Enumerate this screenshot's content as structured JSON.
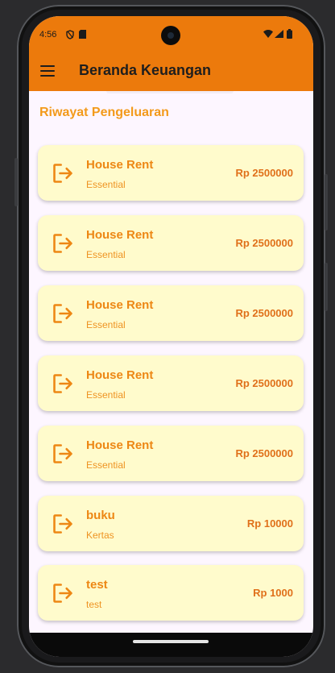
{
  "status_bar": {
    "time": "4:56",
    "left_icons": [
      "shield-icon",
      "sim-card-icon"
    ],
    "right_icons": [
      "wifi-icon",
      "signal-icon",
      "battery-icon"
    ]
  },
  "app_bar": {
    "title": "Beranda Keuangan",
    "menu_icon": "menu-icon",
    "color": "#ec7a0c"
  },
  "section": {
    "title": "Riwayat Pengeluaran"
  },
  "expenses": [
    {
      "name": "House Rent",
      "category": "Essential",
      "amount": "Rp 2500000"
    },
    {
      "name": "House Rent",
      "category": "Essential",
      "amount": "Rp 2500000"
    },
    {
      "name": "House Rent",
      "category": "Essential",
      "amount": "Rp 2500000"
    },
    {
      "name": "House Rent",
      "category": "Essential",
      "amount": "Rp 2500000"
    },
    {
      "name": "House Rent",
      "category": "Essential",
      "amount": "Rp 2500000"
    },
    {
      "name": "buku",
      "category": "Kertas",
      "amount": "Rp 10000"
    },
    {
      "name": "test",
      "category": "test",
      "amount": "Rp 1000"
    }
  ],
  "item_icon": "logout-icon",
  "colors": {
    "card_bg": "#fffbcc",
    "accent": "#ed8714",
    "page_bg": "#fdf6ff"
  }
}
